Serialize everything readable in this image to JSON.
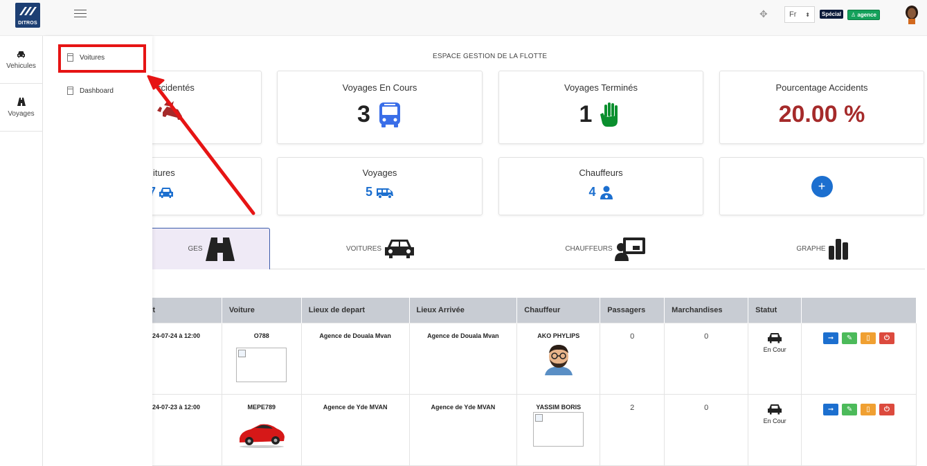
{
  "app": {
    "logo_text": "DITROS"
  },
  "header": {
    "language": "Fr",
    "badge_special": "Spécial",
    "badge_agence": "agence"
  },
  "leftnav": [
    {
      "label": "Vehicules",
      "icon": "car-icon"
    },
    {
      "label": "Voyages",
      "icon": "road-icon"
    }
  ],
  "submenu": [
    {
      "label": "Voitures",
      "icon": "document-icon"
    },
    {
      "label": "Dashboard",
      "icon": "document-icon"
    }
  ],
  "section_title": "ESPACE GESTION DE LA FLOTTE",
  "cards": {
    "accidentes": {
      "title": "ccidentés"
    },
    "voyages_en_cours": {
      "title": "Voyages En Cours",
      "value": "3"
    },
    "voyages_termines": {
      "title": "Voyages Terminés",
      "value": "1"
    },
    "pourcentage": {
      "title": "Pourcentage Accidents",
      "value": "20.00 %"
    },
    "voitures": {
      "title": "itures",
      "value": "7"
    },
    "voyages": {
      "title": "Voyages",
      "value": "5"
    },
    "chauffeurs": {
      "title": "Chauffeurs",
      "value": "4"
    },
    "add": {
      "label": "+"
    }
  },
  "tabs": [
    {
      "label": "GES",
      "icon": "road-icon"
    },
    {
      "label": "VOITURES",
      "icon": "car-icon"
    },
    {
      "label": "CHAUFFEURS",
      "icon": "driver-board-icon"
    },
    {
      "label": "GRAPHE",
      "icon": "bar-chart-icon"
    }
  ],
  "table": {
    "headers": [
      "t",
      "Voiture",
      "Lieux de depart",
      "Lieux Arrivée",
      "Chauffeur",
      "Passagers",
      "Marchandises",
      "Statut",
      ""
    ],
    "rows": [
      {
        "date": "024-07-24 à 12:00",
        "voiture": "O788",
        "depart": "Agence de Douala Mvan",
        "arrivee": "Agence de Douala Mvan",
        "chauffeur": "AKO PHYLIPS",
        "passagers": "0",
        "marchandises": "0",
        "statut": "En Cour"
      },
      {
        "date": "024-07-23 à 12:00",
        "voiture": "MEPE789",
        "depart": "Agence de Yde MVAN",
        "arrivee": "Agence de Yde MVAN",
        "chauffeur": "YASSIM BORIS",
        "passagers": "2",
        "marchandises": "0",
        "statut": "En Cour"
      }
    ]
  },
  "colors": {
    "accent": "#1c6fcf",
    "danger": "#a52a2a",
    "success": "#14a15b",
    "highlight": "#e61414"
  }
}
